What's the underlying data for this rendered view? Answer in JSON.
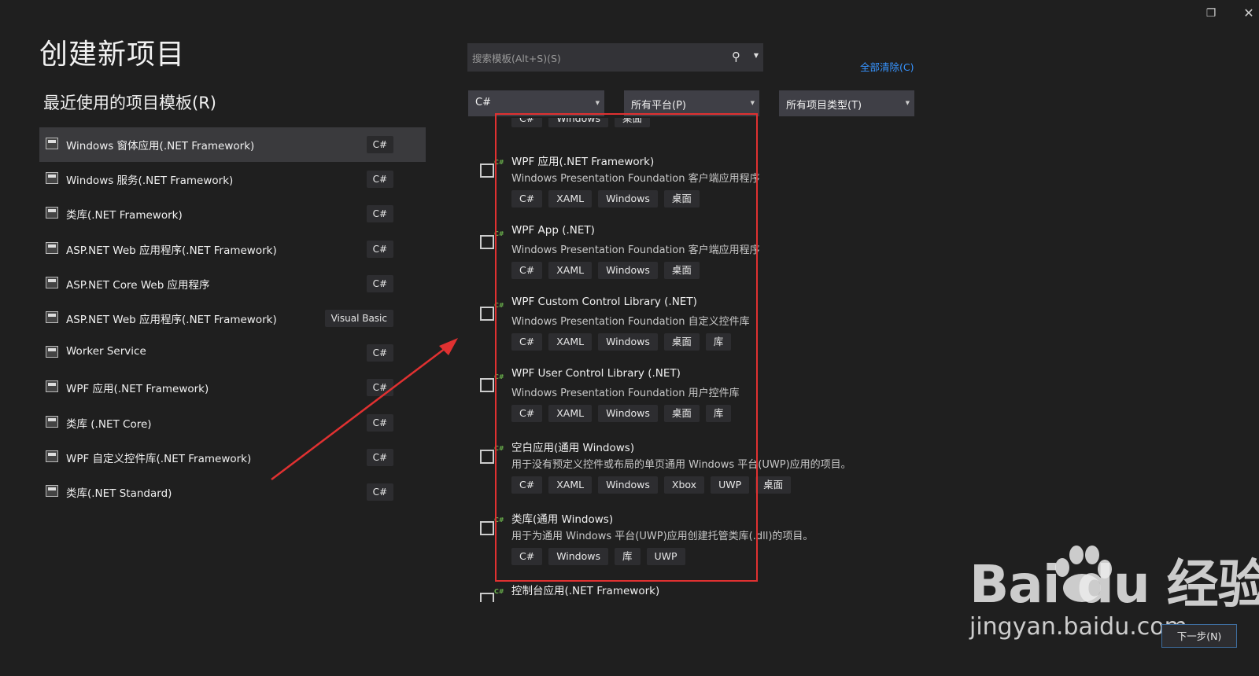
{
  "title": "创建新项目",
  "recent_header": "最近使用的项目模板(R)",
  "recent_items": [
    {
      "name": "Windows 窗体应用(.NET Framework)",
      "lang": "C#"
    },
    {
      "name": "Windows 服务(.NET Framework)",
      "lang": "C#"
    },
    {
      "name": "类库(.NET Framework)",
      "lang": "C#"
    },
    {
      "name": "ASP.NET Web 应用程序(.NET Framework)",
      "lang": "C#"
    },
    {
      "name": "ASP.NET Core Web 应用程序",
      "lang": "C#"
    },
    {
      "name": "ASP.NET Web 应用程序(.NET Framework)",
      "lang": "Visual Basic"
    },
    {
      "name": "Worker Service",
      "lang": "C#"
    },
    {
      "name": "WPF 应用(.NET Framework)",
      "lang": "C#"
    },
    {
      "name": "类库 (.NET Core)",
      "lang": "C#"
    },
    {
      "name": "WPF 自定义控件库(.NET Framework)",
      "lang": "C#"
    },
    {
      "name": "类库(.NET Standard)",
      "lang": "C#"
    }
  ],
  "search": {
    "placeholder": "搜索模板(Alt+S)(S)"
  },
  "clear_all": "全部清除(C)",
  "filters": {
    "language": "C#",
    "platform": "所有平台(P)",
    "project_type": "所有项目类型(T)"
  },
  "partial_top_tags": [
    "C#",
    "Windows",
    "桌面"
  ],
  "templates": [
    {
      "name": "WPF 应用(.NET Framework)",
      "desc": "Windows Presentation Foundation 客户端应用程序",
      "tags": [
        "C#",
        "XAML",
        "Windows",
        "桌面"
      ]
    },
    {
      "name": "WPF App (.NET)",
      "desc": "Windows Presentation Foundation 客户端应用程序",
      "tags": [
        "C#",
        "XAML",
        "Windows",
        "桌面"
      ]
    },
    {
      "name": "WPF Custom Control Library (.NET)",
      "desc": "Windows Presentation Foundation 自定义控件库",
      "tags": [
        "C#",
        "XAML",
        "Windows",
        "桌面",
        "库"
      ]
    },
    {
      "name": "WPF User Control Library (.NET)",
      "desc": "Windows Presentation Foundation 用户控件库",
      "tags": [
        "C#",
        "XAML",
        "Windows",
        "桌面",
        "库"
      ]
    },
    {
      "name": "空白应用(通用 Windows)",
      "desc": "用于没有预定义控件或布局的单页通用 Windows 平台(UWP)应用的项目。",
      "tags": [
        "C#",
        "XAML",
        "Windows",
        "Xbox",
        "UWP",
        "桌面"
      ]
    },
    {
      "name": "类库(通用 Windows)",
      "desc": "用于为通用 Windows 平台(UWP)应用创建托管类库(.dll)的项目。",
      "tags": [
        "C#",
        "Windows",
        "库",
        "UWP"
      ]
    },
    {
      "name": "控制台应用(.NET Framework)",
      "desc": "",
      "tags": []
    }
  ],
  "next_button": "下一步(N)",
  "watermark": {
    "logo": "Bai du 经验",
    "url": "jingyan.baidu.com"
  },
  "colors": {
    "background": "#1f1f1f",
    "accent": "#3794ff",
    "highlight": "#e03131"
  }
}
